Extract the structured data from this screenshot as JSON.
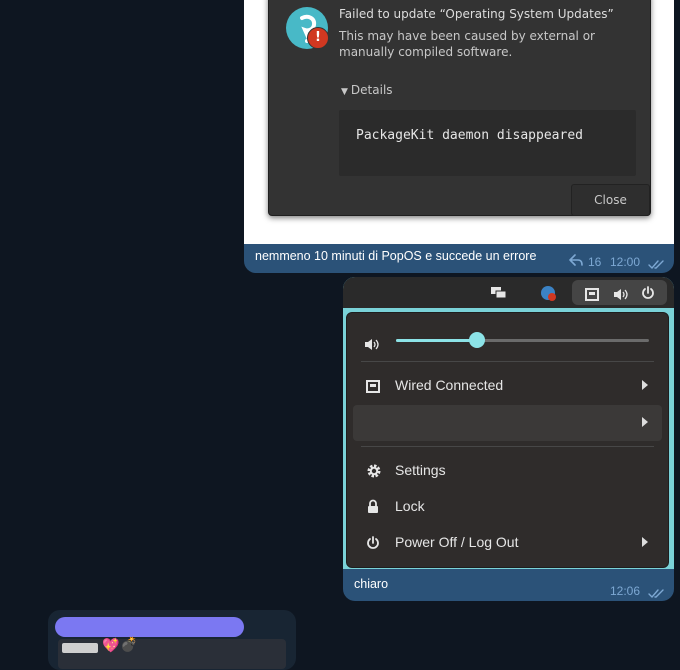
{
  "error_dialog": {
    "title": "Failed to update “Operating System Updates”",
    "description": "This may have been caused by external or manually compiled software.",
    "details_label": "Details",
    "details_text": "PackageKit daemon disappeared",
    "close_label": "Close",
    "badge": "!"
  },
  "message1": {
    "caption": "nemmeno 10 minuti di PopOS e succede un errore",
    "replies": "16",
    "time": "12:00"
  },
  "system_menu": {
    "volume_percent": 32,
    "wired_label": "Wired Connected",
    "empty_row_label": "",
    "settings_label": "Settings",
    "lock_label": "Lock",
    "power_label": "Power Off / Log Out"
  },
  "message2": {
    "caption": "chiaro",
    "time": "12:06"
  },
  "message3": {
    "emoji_heart": "💖",
    "emoji_bomb": "💣"
  },
  "colors": {
    "chat_background": "#0e1621",
    "outgoing_bubble": "#2b5278",
    "accent_cyan": "#8ce3e7",
    "pop_logo": "#48b9c7",
    "error_red": "#d03821"
  }
}
